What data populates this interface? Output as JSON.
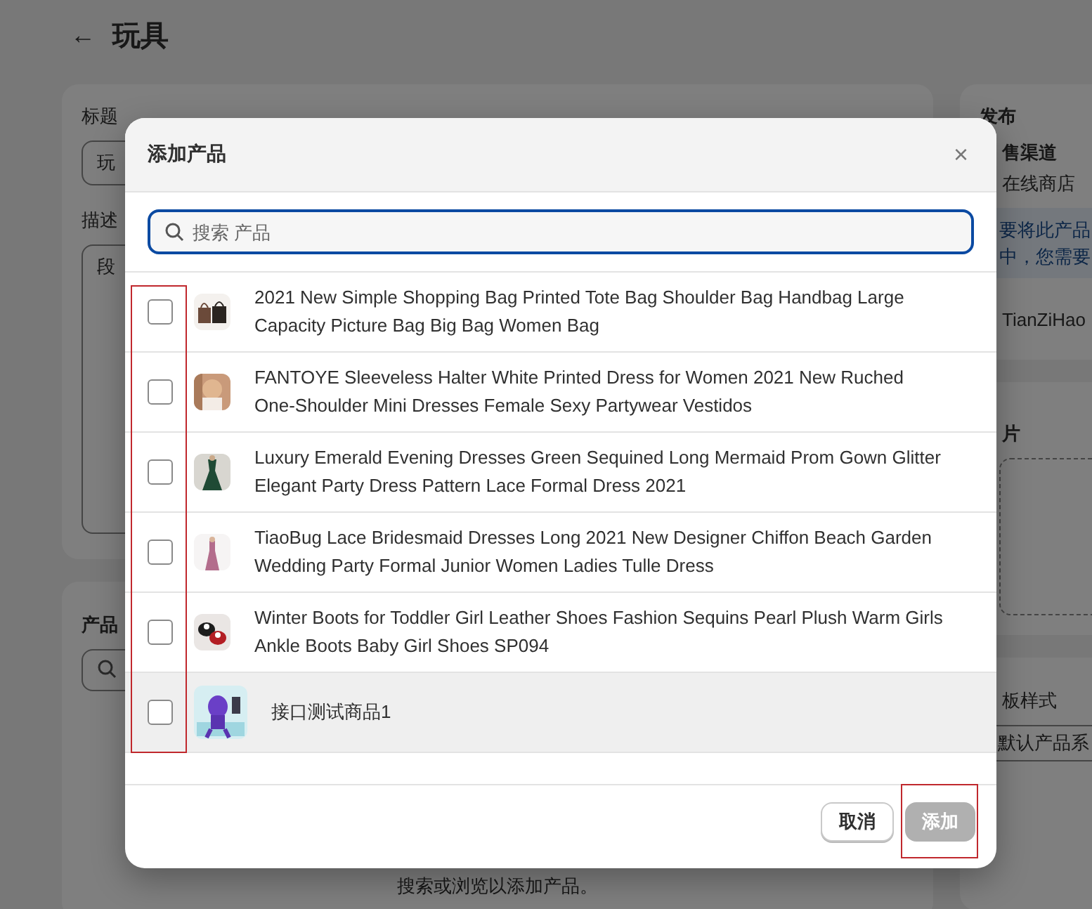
{
  "page": {
    "back_arrow": "←",
    "title": "玩具"
  },
  "main_card": {
    "title_label": "标题",
    "title_value": "玩",
    "description_label": "描述",
    "editor_text": "段"
  },
  "products_card": {
    "heading": "产品",
    "hint": "搜索或浏览以添加产品。"
  },
  "publish_card": {
    "heading": "发布",
    "channels_label": "售渠道",
    "channel": "在线商店",
    "notice_lines": [
      "要将此产品",
      "中，您需要"
    ],
    "store": "TianZiHao"
  },
  "images_card": {
    "heading": "片"
  },
  "template_card": {
    "label": "板样式",
    "value": "默认产品系"
  },
  "modal": {
    "title": "添加产品",
    "close": "×",
    "search": {
      "placeholder": "搜索 产品"
    },
    "products": [
      {
        "title": "2021 New Simple Shopping Bag Printed Tote Bag Shoulder Bag Handbag Large Capacity Picture Bag Big Bag Women Bag",
        "checked": false,
        "highlighted": false
      },
      {
        "title": "FANTOYE Sleeveless Halter White Printed Dress for Women 2021 New Ruched One-Shoulder Mini Dresses Female Sexy Partywear Vestidos",
        "checked": false,
        "highlighted": false
      },
      {
        "title": "Luxury Emerald Evening Dresses Green Sequined Long Mermaid Prom Gown Glitter Elegant Party Dress Pattern Lace Formal Dress 2021",
        "checked": false,
        "highlighted": false
      },
      {
        "title": "TiaoBug Lace Bridesmaid Dresses Long 2021 New Designer Chiffon Beach Garden Wedding Party Formal Junior Women Ladies Tulle Dress",
        "checked": false,
        "highlighted": false
      },
      {
        "title": "Winter Boots for Toddler Girl Leather Shoes Fashion Sequins Pearl Plush Warm Girls Ankle Boots Baby Girl Shoes SP094",
        "checked": false,
        "highlighted": false
      },
      {
        "title": "接口测试商品1",
        "checked": false,
        "highlighted": true
      }
    ],
    "buttons": [
      {
        "label": "取消",
        "kind": "secondary",
        "disabled": false
      },
      {
        "label": "添加",
        "kind": "primary",
        "disabled": true
      }
    ]
  }
}
